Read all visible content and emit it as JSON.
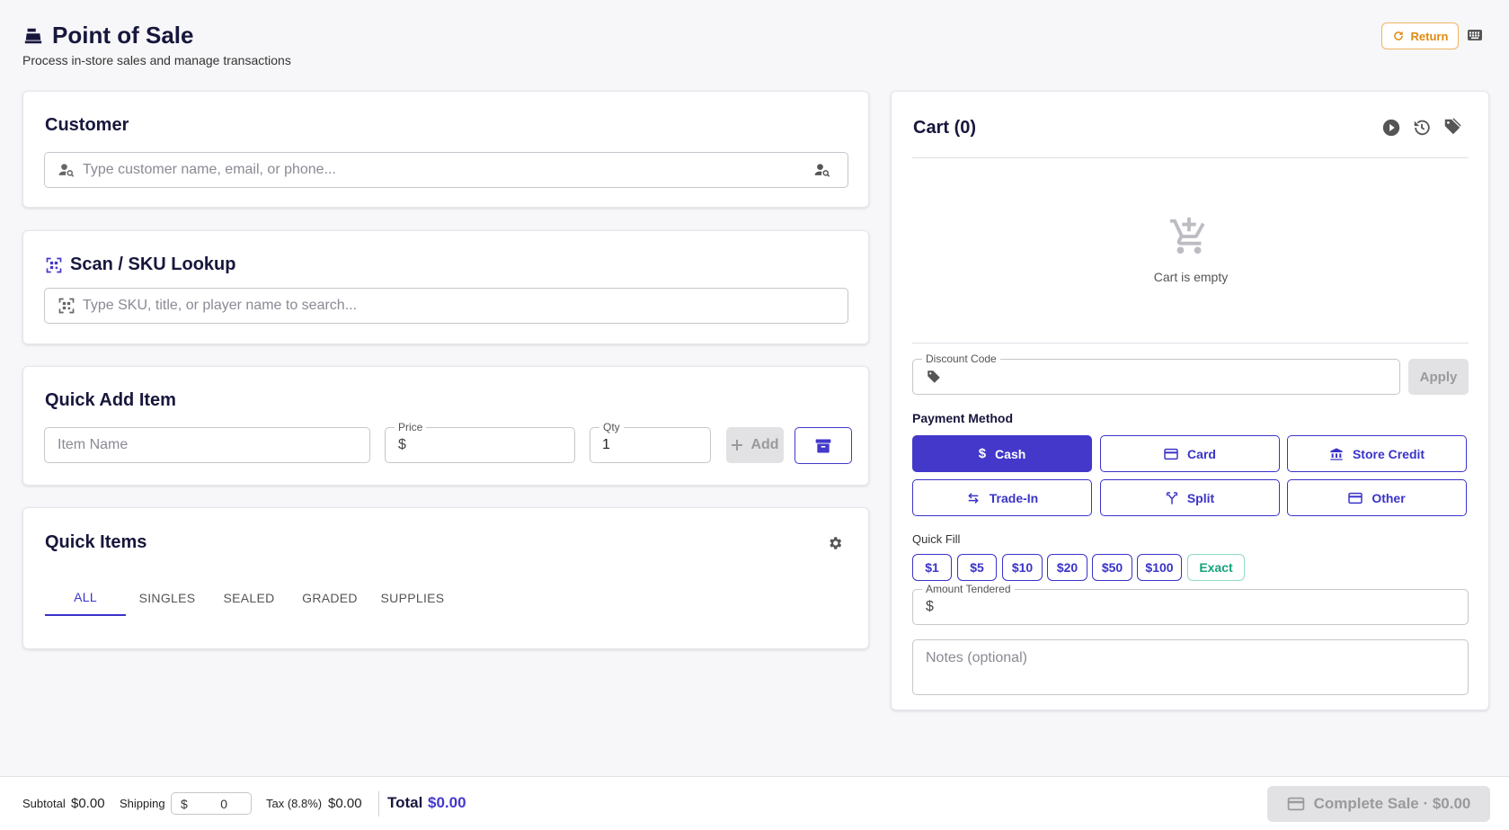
{
  "header": {
    "title": "Point of Sale",
    "subtitle": "Process in-store sales and manage transactions",
    "return_label": "Return"
  },
  "customer": {
    "title": "Customer",
    "placeholder": "Type customer name, email, or phone..."
  },
  "scan": {
    "title": "Scan / SKU Lookup",
    "placeholder": "Type SKU, title, or player name to search..."
  },
  "quick_add": {
    "title": "Quick Add Item",
    "item_placeholder": "Item Name",
    "price_label": "Price",
    "price_prefix": "$",
    "qty_label": "Qty",
    "qty_value": "1",
    "add_label": "Add"
  },
  "quick_items": {
    "title": "Quick Items",
    "tabs": [
      "ALL",
      "SINGLES",
      "SEALED",
      "GRADED",
      "SUPPLIES"
    ],
    "active_tab": "ALL"
  },
  "cart": {
    "title": "Cart (0)",
    "empty_text": "Cart is empty",
    "discount_label": "Discount Code",
    "apply_label": "Apply",
    "payment_title": "Payment Method",
    "payment_methods": [
      "Cash",
      "Card",
      "Store Credit",
      "Trade-In",
      "Split",
      "Other"
    ],
    "active_payment": "Cash",
    "quick_fill_label": "Quick Fill",
    "quick_fill": [
      "$1",
      "$5",
      "$10",
      "$20",
      "$50",
      "$100",
      "Exact"
    ],
    "amount_label": "Amount Tendered",
    "amount_prefix": "$",
    "notes_placeholder": "Notes (optional)"
  },
  "footer": {
    "subtotal_label": "Subtotal",
    "subtotal_value": "$0.00",
    "shipping_label": "Shipping",
    "shipping_prefix": "$",
    "shipping_value": "0",
    "tax_label": "Tax (8.8%)",
    "tax_value": "$0.00",
    "total_label": "Total",
    "total_value": "$0.00",
    "complete_label": "Complete Sale · $0.00"
  },
  "colors": {
    "primary": "#4338ca",
    "accent_orange": "#e08b12",
    "success": "#16a37a"
  }
}
